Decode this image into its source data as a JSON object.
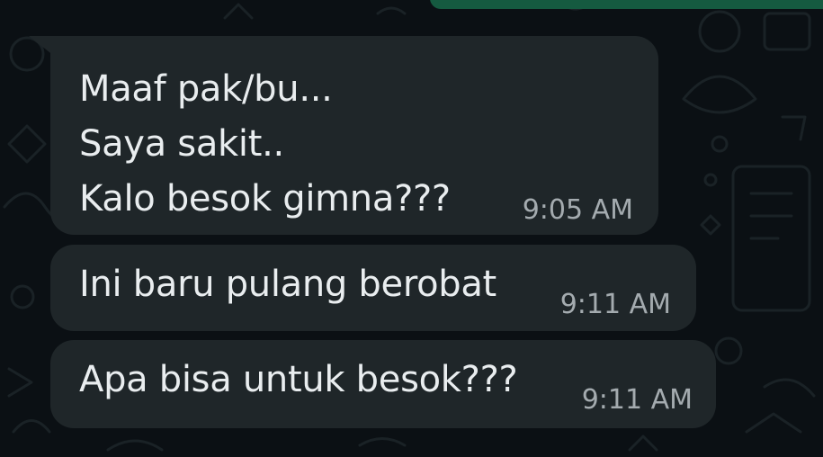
{
  "chat": {
    "messages": [
      {
        "lines": "Maaf pak/bu...\nSaya sakit..\nKalo besok gimna???",
        "time": "9:05 AM"
      },
      {
        "lines": "Ini baru pulang berobat",
        "time": "9:11 AM"
      },
      {
        "lines": "Apa bisa untuk besok???",
        "time": "9:11 AM"
      }
    ]
  },
  "colors": {
    "background": "#0b1014",
    "bubble": "#1f2629",
    "text": "#e9edef",
    "timestamp": "#a4abaf",
    "outgoing_bubble": "#155a40"
  }
}
